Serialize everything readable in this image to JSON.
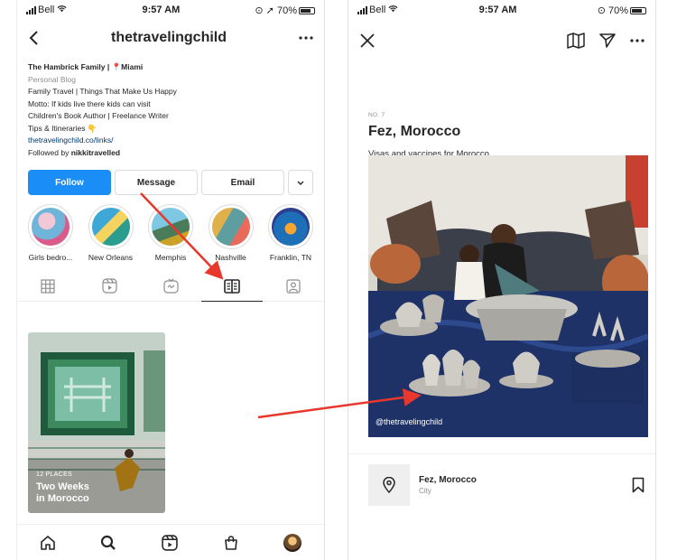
{
  "left": {
    "status": {
      "carrier": "Bell",
      "time": "9:57 AM",
      "battery": "70%"
    },
    "header": {
      "username": "thetravelingchild"
    },
    "bio": {
      "name": "The Hambrick Family | 📍Miami",
      "category": "Personal Blog",
      "lines": [
        "Family Travel | Things That Make Us Happy",
        "Motto: If kids live there kids can visit",
        "Children's Book Author | Freelance Writer",
        "Tips & Itineraries 👇"
      ],
      "link": "thetravelingchild.co/links/",
      "followed_prefix": "Followed by ",
      "followed_user": "nikkitravelled"
    },
    "buttons": {
      "follow": "Follow",
      "message": "Message",
      "email": "Email"
    },
    "highlights": [
      {
        "label": "Girls bedro..."
      },
      {
        "label": "New Orleans"
      },
      {
        "label": "Memphis"
      },
      {
        "label": "Nashville"
      },
      {
        "label": "Franklin, TN"
      }
    ],
    "tabs": [
      "grid-icon",
      "reels-icon",
      "igtv-icon",
      "guides-icon",
      "tagged-icon"
    ],
    "guide": {
      "count": "12 PLACES",
      "title_line1": "Two Weeks",
      "title_line2": "in Morocco"
    },
    "bottom_nav": [
      "home-icon",
      "search-icon",
      "reels-icon",
      "shop-icon",
      "profile-avatar"
    ]
  },
  "right": {
    "status": {
      "carrier": "Bell",
      "time": "9:57 AM",
      "battery": "70%"
    },
    "guide": {
      "number": "NO. 7",
      "title": "Fez, Morocco",
      "subtitle": "Visas and vaccines for Morocco",
      "photo_credit": "@thetravelingchild"
    },
    "place": {
      "name": "Fez, Morocco",
      "type": "City"
    }
  },
  "colors": {
    "follow_blue": "#1a8df6",
    "arrow_red": "#e8372c"
  }
}
